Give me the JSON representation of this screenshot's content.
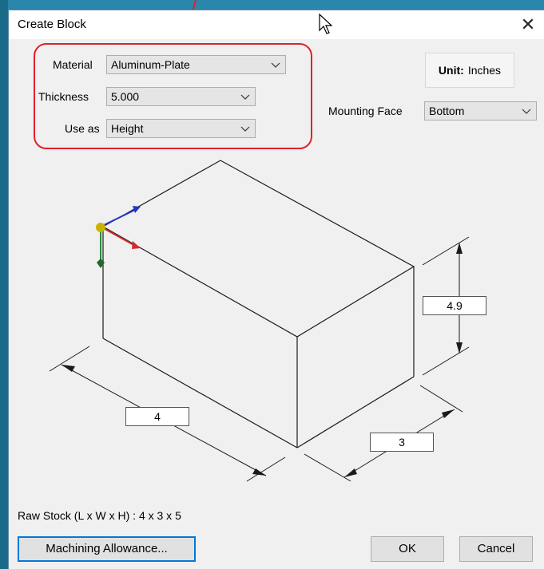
{
  "window": {
    "title": "Create Block"
  },
  "form": {
    "material_label": "Material",
    "material_value": "Aluminum-Plate",
    "thickness_label": "Thickness",
    "thickness_value": "5.000",
    "use_as_label": "Use as",
    "use_as_value": "Height",
    "mounting_face_label": "Mounting Face",
    "mounting_face_value": "Bottom"
  },
  "unit": {
    "label": "Unit:",
    "value": "Inches"
  },
  "drawing": {
    "length": "4",
    "width": "3",
    "height": "4.9"
  },
  "raw_stock": "Raw Stock (L x W x H) :  4 x 3 x 5",
  "buttons": {
    "allowance": "Machining Allowance...",
    "ok": "OK",
    "cancel": "Cancel"
  },
  "colors": {
    "callout": "#e0202a",
    "axis_x": "#d42a2a",
    "axis_y": "#2a8a3a",
    "axis_z": "#2636c8",
    "origin": "#c8b400"
  }
}
